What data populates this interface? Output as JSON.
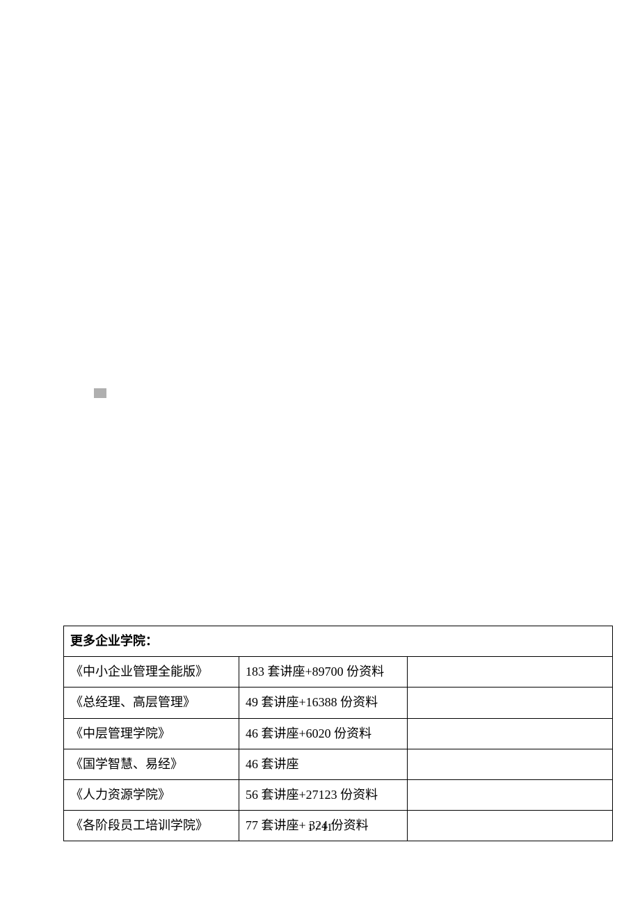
{
  "header": {
    "title": "更多企业学院："
  },
  "rows": [
    {
      "name": "《中小企业管理全能版》",
      "desc": "183 套讲座+89700 份资料"
    },
    {
      "name": "《总经理、高层管理》",
      "desc": "49 套讲座+16388 份资料"
    },
    {
      "name": "《中层管理学院》",
      "desc": "46 套讲座+6020 份资料"
    },
    {
      "name": "《国学智慧、易经》",
      "desc": "46 套讲座"
    },
    {
      "name": "《人力资源学院》",
      "desc": "56 套讲座+27123 份资料"
    },
    {
      "name": "《各阶段员工培训学院》",
      "desc": "77 套讲座+ 324 份资料"
    }
  ],
  "footer": {
    "page": "1 / 11"
  }
}
